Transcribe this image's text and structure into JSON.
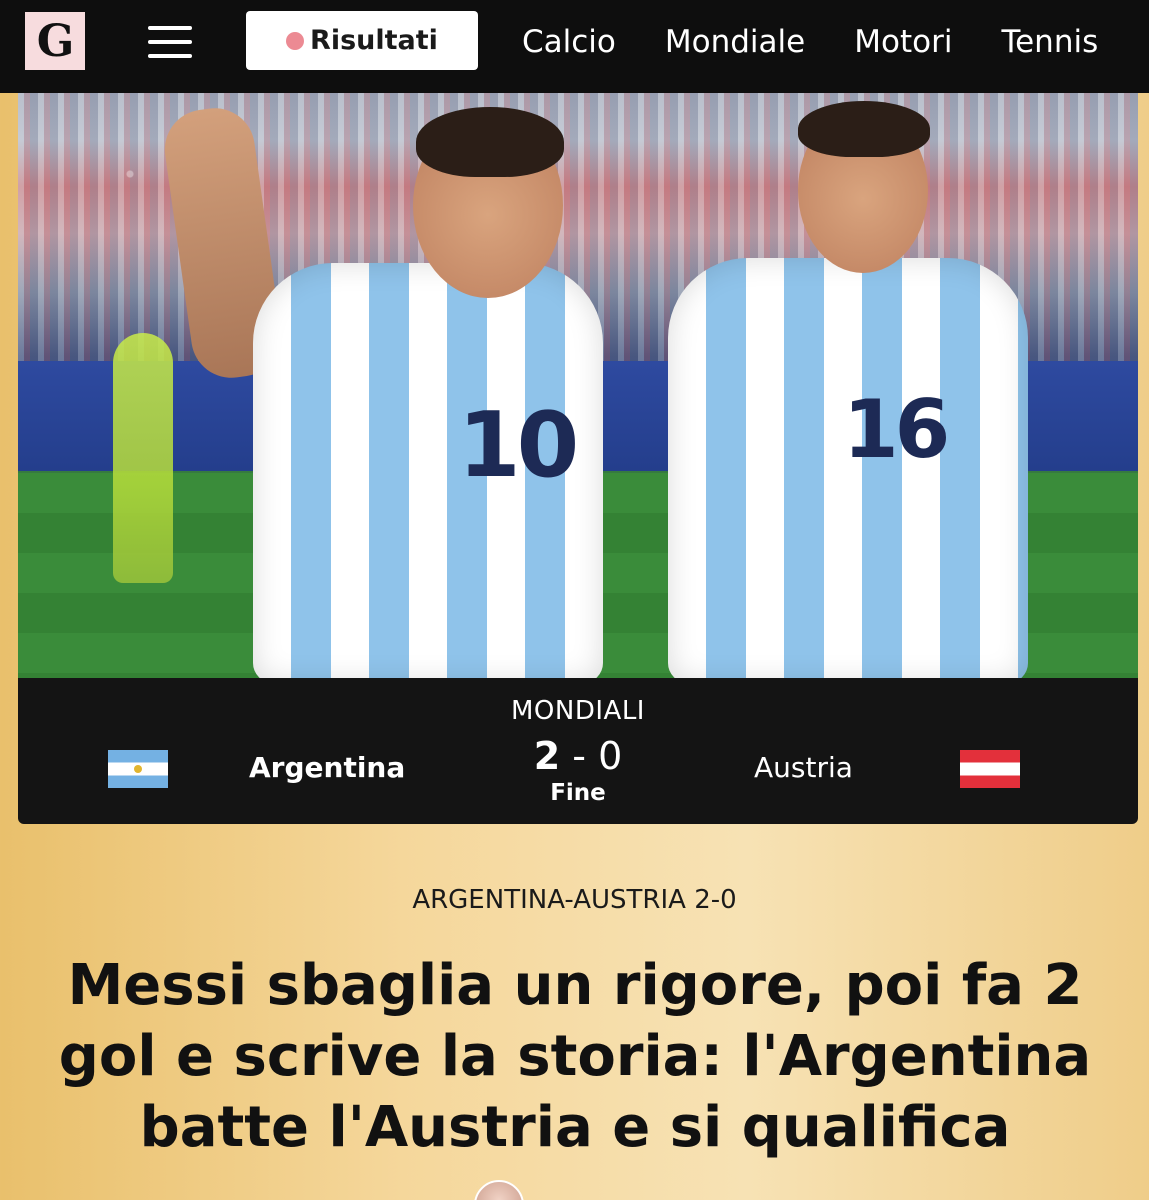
{
  "header": {
    "logo_text": "G",
    "menu_icon": "hamburger-menu-icon",
    "results_label": "Risultati",
    "results_dot_color": "#ec8a93",
    "nav": [
      "Calcio",
      "Mondiale",
      "Motori",
      "Tennis"
    ]
  },
  "hero": {
    "shirt_numbers": [
      "10",
      "16"
    ]
  },
  "match": {
    "competition": "MONDIALI",
    "home_team": "Argentina",
    "home_score": "2",
    "separator": "-",
    "away_score": "0",
    "away_team": "Austria",
    "status": "Fine",
    "home_flag": "argentina-flag-icon",
    "away_flag": "austria-flag-icon"
  },
  "article": {
    "kicker": "ARGENTINA-AUSTRIA 2-0",
    "headline": "Messi sbaglia un rigore, poi fa 2 gol e scrive la storia: l'Argentina batte l'Austria e si qualifica"
  },
  "colors": {
    "topbar": "#0e0e0e",
    "scorebar": "#141414",
    "logo_bg": "#f7dcde",
    "page_bg": "#f5d79b"
  }
}
